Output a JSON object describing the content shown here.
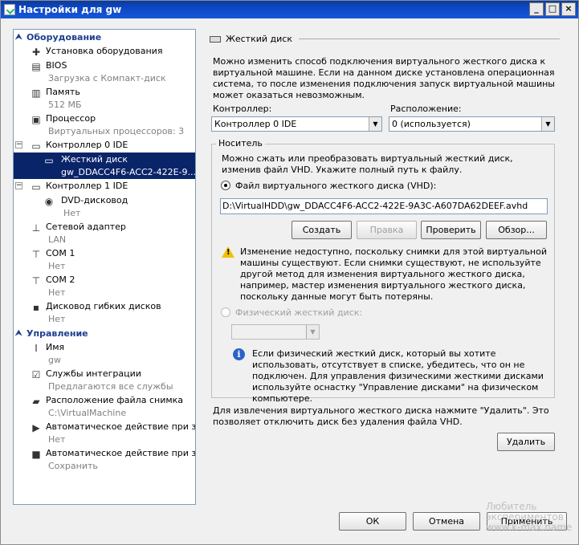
{
  "window": {
    "title": "Настройки для gw"
  },
  "tree": {
    "sections": [
      {
        "label": "Оборудование"
      },
      {
        "label": "Управление"
      }
    ],
    "hardware": [
      {
        "label": "Установка оборудования",
        "sub": ""
      },
      {
        "label": "BIOS",
        "sub": "Загрузка с Компакт-диск"
      },
      {
        "label": "Память",
        "sub": "512 МБ"
      },
      {
        "label": "Процессор",
        "sub": "Виртуальных процессоров: 3"
      },
      {
        "label": "Контроллер 0 IDE",
        "sub": ""
      },
      {
        "label": "Жесткий диск",
        "sub": "gw_DDACC4F6-ACC2-422E-9..."
      },
      {
        "label": "Контроллер 1 IDE",
        "sub": ""
      },
      {
        "label": "DVD-дисковод",
        "sub": "Нет"
      },
      {
        "label": "Сетевой адаптер",
        "sub": "LAN"
      },
      {
        "label": "COM 1",
        "sub": "Нет"
      },
      {
        "label": "COM 2",
        "sub": "Нет"
      },
      {
        "label": "Дисковод гибких дисков",
        "sub": "Нет"
      }
    ],
    "management": [
      {
        "label": "Имя",
        "sub": "gw"
      },
      {
        "label": "Службы интеграции",
        "sub": "Предлагаются все службы"
      },
      {
        "label": "Расположение файла снимка",
        "sub": "C:\\VirtualMachine"
      },
      {
        "label": "Автоматическое действие при за...",
        "sub": "Нет"
      },
      {
        "label": "Автоматическое действие при за...",
        "sub": "Сохранить"
      }
    ]
  },
  "detail": {
    "heading": "Жесткий диск",
    "intro": "Можно изменить способ подключения виртуального жесткого диска к виртуальной машине. Если на данном диске установлена операционная система, то после изменения подключения запуск виртуальной машины может оказаться невозможным.",
    "controller_label": "Контроллер:",
    "controller_value": "Контроллер 0 IDE",
    "location_label": "Расположение:",
    "location_value": "0 (используется)",
    "media_legend": "Носитель",
    "media_text": "Можно сжать или преобразовать виртуальный жесткий диск, изменив файл VHD. Укажите полный путь к файлу.",
    "vhd_option": "Файл виртуального жесткого диска (VHD):",
    "vhd_path": "D:\\VirtualHDD\\gw_DDACC4F6-ACC2-422E-9A3C-A607DA62DEEF.avhd",
    "btn_create": "Создать",
    "btn_edit": "Правка",
    "btn_inspect": "Проверить",
    "btn_browse": "Обзор...",
    "warning_text": "Изменение недоступно, поскольку снимки для этой виртуальной машины существуют. Если снимки существуют, не используйте другой метод для изменения виртуального жесткого диска, например, мастер изменения виртуального жесткого диска, поскольку данные могут быть потеряны.",
    "physical_option": "Физический жесткий диск:",
    "info_text": "Если физический жесткий диск, который вы хотите использовать, отсутствует в списке, убедитесь, что он не подключен. Для управления физическими жесткими дисками используйте оснастку \"Управление дисками\" на физическом компьютере.",
    "remove_text": "Для извлечения виртуального жесткого диска нажмите \"Удалить\". Это позволяет отключить диск без удаления файла VHD.",
    "btn_remove": "Удалить"
  },
  "footer": {
    "ok": "ОК",
    "cancel": "Отмена",
    "apply": "Применить"
  },
  "watermark": {
    "line1": "Любитель",
    "line2": "экспериментов",
    "line3": "www.k-max.name"
  }
}
